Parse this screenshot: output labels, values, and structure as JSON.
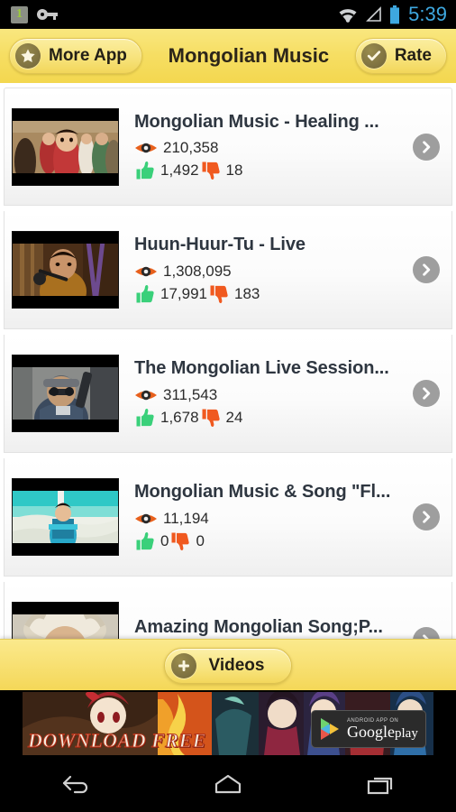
{
  "statusbar": {
    "time": "5:39",
    "notification_badge": "1",
    "icons": [
      "notification-badge-1-icon",
      "vpn-key-icon",
      "wifi-icon",
      "signal-icon",
      "battery-icon"
    ]
  },
  "header": {
    "title": "Mongolian Music",
    "more_app_label": "More App",
    "rate_label": "Rate",
    "accent_color": "#f6de63",
    "badge_color": "#7d7040"
  },
  "list": {
    "items": [
      {
        "title": "Mongolian Music - Healing ...",
        "views": "210,358",
        "likes": "1,492",
        "dislikes": "18"
      },
      {
        "title": "Huun-Huur-Tu - Live",
        "views": "1,308,095",
        "likes": "17,991",
        "dislikes": "183"
      },
      {
        "title": "The Mongolian Live Session...",
        "views": "311,543",
        "likes": "1,678",
        "dislikes": "24"
      },
      {
        "title": "Mongolian Music & Song \"Fl...",
        "views": "11,194",
        "likes": "0",
        "dislikes": "0"
      },
      {
        "title": "Amazing Mongolian Song;P...",
        "views": "",
        "likes": "",
        "dislikes": ""
      }
    ],
    "colors": {
      "views_icon": "#e8601c",
      "like_icon": "#3ad07a",
      "dislike_icon": "#f0591f",
      "arrow_button": "#9e9e9e"
    }
  },
  "footer": {
    "videos_label": "Videos"
  },
  "ad": {
    "download_text": "DOWNLOAD FREE",
    "store_small": "ANDROID APP ON",
    "store_name": "Google",
    "store_suffix": "play"
  },
  "navbar": {
    "back_label": "Back",
    "home_label": "Home",
    "recents_label": "Recent apps"
  }
}
